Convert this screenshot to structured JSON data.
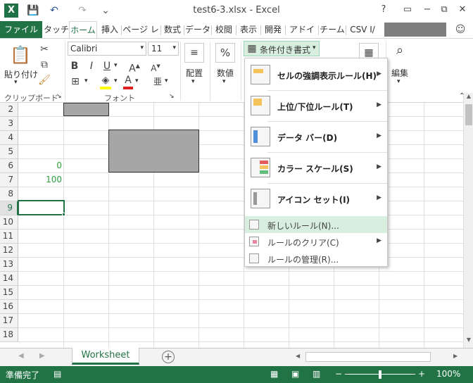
{
  "window": {
    "title": "test6-3.xlsx - Excel",
    "help": "?",
    "minimize": "−",
    "restore": "⧉",
    "close": "✕"
  },
  "qat": {
    "logo": "X",
    "save": "💾",
    "undo": "↶",
    "redo": "↷",
    "more": "⌄"
  },
  "tabs": [
    "ファイル",
    "タッチ",
    "ホーム",
    "挿入",
    "ページ レ",
    "数式",
    "データ",
    "校閲",
    "表示",
    "開発",
    "アドイン",
    "チーム",
    "CSV I/"
  ],
  "ribbon": {
    "paste_label": "貼り付け",
    "clipboard_label": "クリップボード",
    "font_name": "Calibri",
    "font_size": "11",
    "bold": "B",
    "italic": "I",
    "underline": "U",
    "grow": "A",
    "shrink": "A",
    "font_label": "フォント",
    "align_label": "配置",
    "number_label": "数値",
    "number_icon": "%",
    "cond_format_label": "条件付き書式",
    "edit_label": "編集"
  },
  "grid": {
    "rows": [
      "2",
      "3",
      "4",
      "5",
      "6",
      "7",
      "8",
      "9",
      "10",
      "11",
      "12",
      "13",
      "14",
      "15",
      "16",
      "17",
      "18"
    ],
    "values": [
      {
        "row": "6",
        "value": "0"
      },
      {
        "row": "7",
        "value": "100"
      }
    ]
  },
  "sheets": {
    "active": "Worksheet",
    "add": "+"
  },
  "status": {
    "ready": "準備完了",
    "zoom": "100%",
    "minus": "−",
    "plus": "+"
  },
  "menu": {
    "items": [
      {
        "label": "セルの強調表示ルール(H)"
      },
      {
        "label": "上位/下位ルール(T)"
      },
      {
        "label": "データ バー(D)"
      },
      {
        "label": "カラー スケール(S)"
      },
      {
        "label": "アイコン セット(I)"
      }
    ],
    "small_items": [
      {
        "label": "新しいルール(N)..."
      },
      {
        "label": "ルールのクリア(C)"
      },
      {
        "label": "ルールの管理(R)..."
      }
    ]
  },
  "colors": {
    "excel_green": "#217346",
    "value_green": "#2e9e3e",
    "highlight": "#d8eedf"
  }
}
